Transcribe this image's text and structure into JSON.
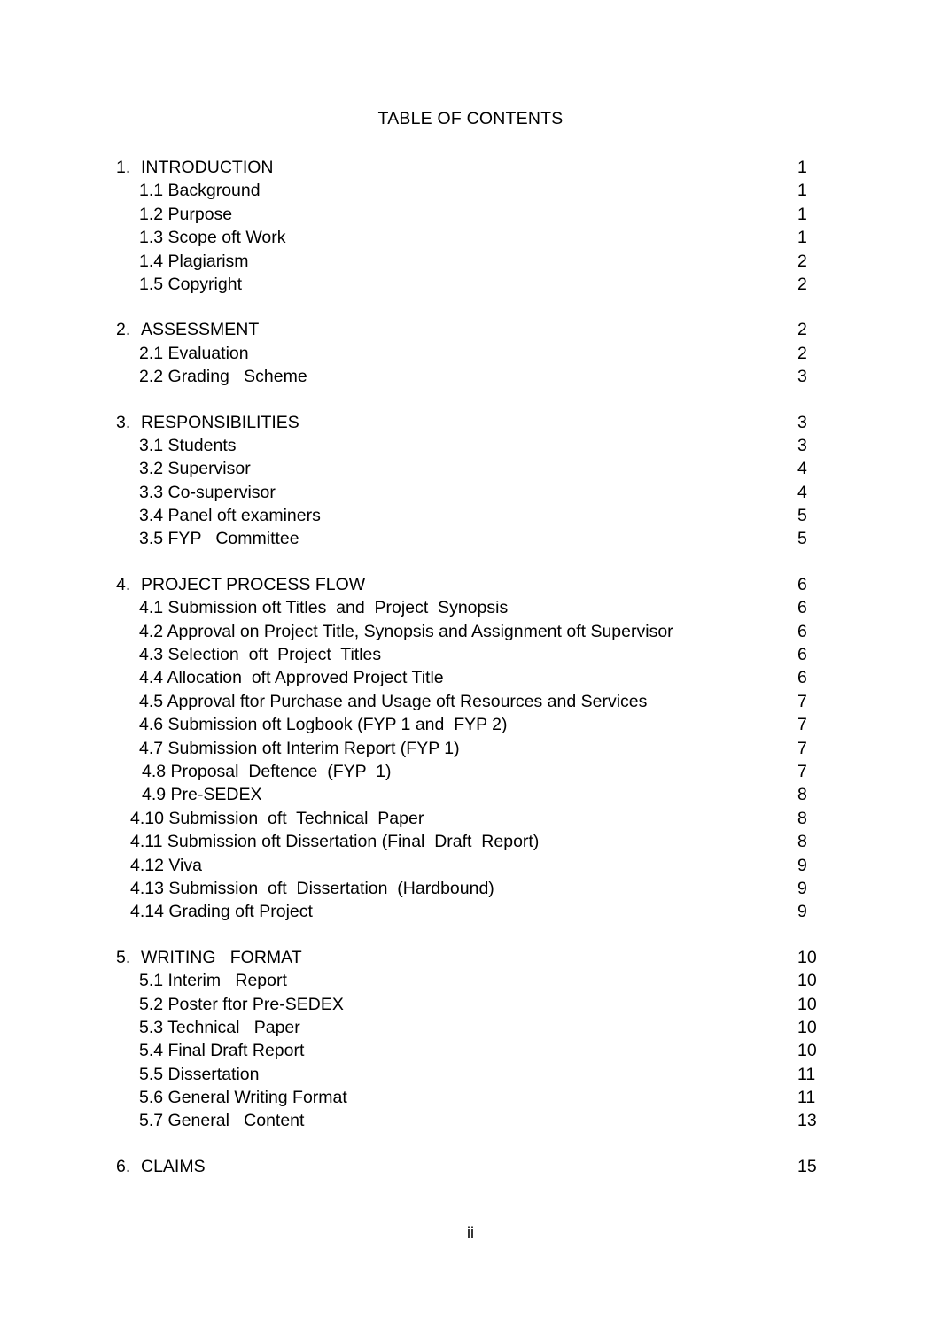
{
  "document": {
    "title": "TABLE OF CONTENTS",
    "folio": "ii"
  },
  "toc": {
    "sections": [
      {
        "number": "1.",
        "title": "INTRODUCTION",
        "page": "1",
        "items": [
          {
            "label": "1.1 Background",
            "page": "1"
          },
          {
            "label": "1.2 Purpose",
            "page": "1"
          },
          {
            "label": "1.3 Scope oft Work",
            "page": "1"
          },
          {
            "label": "1.4 Plagiarism",
            "page": "2"
          },
          {
            "label": "1.5 Copyright",
            "page": "2"
          }
        ]
      },
      {
        "number": "2.",
        "title": "ASSESSMENT",
        "page": "2",
        "items": [
          {
            "label": "2.1 Evaluation",
            "page": "2"
          },
          {
            "label": "2.2 Grading   Scheme",
            "page": "3"
          }
        ]
      },
      {
        "number": "3.",
        "title": "RESPONSIBILITIES",
        "page": "3",
        "items": [
          {
            "label": "3.1 Students",
            "page": "3"
          },
          {
            "label": "3.2 Supervisor",
            "page": "4"
          },
          {
            "label": "3.3 Co-supervisor",
            "page": "4"
          },
          {
            "label": "3.4 Panel oft examiners",
            "page": "5"
          },
          {
            "label": "3.5 FYP   Committee",
            "page": "5"
          }
        ]
      },
      {
        "number": "4.",
        "title": "PROJECT PROCESS FLOW",
        "page": "6",
        "items": [
          {
            "label": "4.1 Submission oft Titles  and  Project  Synopsis",
            "page": "6"
          },
          {
            "label": "4.2 Approval on Project Title, Synopsis and Assignment oft Supervisor",
            "page": "6"
          },
          {
            "label": "4.3 Selection  oft  Project  Titles",
            "page": "6"
          },
          {
            "label": "4.4 Allocation  oft Approved Project Title",
            "page": "6"
          },
          {
            "label": "4.5 Approval ftor Purchase and Usage oft Resources and Services",
            "page": "7"
          },
          {
            "label": "4.6 Submission oft Logbook (FYP 1 and  FYP 2)",
            "page": "7"
          },
          {
            "label": "4.7 Submission oft Interim Report (FYP 1)",
            "page": "7"
          },
          {
            "label": "4.8 Proposal  Deftence  (FYP  1)",
            "page": "7",
            "indent": "a"
          },
          {
            "label": "4.9 Pre-SEDEX",
            "page": "8",
            "indent": "a"
          },
          {
            "label": "4.10 Submission  oft  Technical  Paper",
            "page": "8",
            "indent": "b"
          },
          {
            "label": "4.11 Submission oft Dissertation (Final  Draft  Report)",
            "page": "8",
            "indent": "b"
          },
          {
            "label": "4.12 Viva",
            "page": "9",
            "indent": "b"
          },
          {
            "label": "4.13 Submission  oft  Dissertation  (Hardbound)",
            "page": "9",
            "indent": "b"
          },
          {
            "label": "4.14 Grading oft Project",
            "page": "9",
            "indent": "b"
          }
        ]
      },
      {
        "number": "5.",
        "title": "WRITING   FORMAT",
        "page": "10",
        "items": [
          {
            "label": "5.1 Interim   Report",
            "page": "10"
          },
          {
            "label": "5.2 Poster ftor Pre-SEDEX",
            "page": "10"
          },
          {
            "label": "5.3 Technical   Paper",
            "page": "10"
          },
          {
            "label": "5.4 Final Draft Report",
            "page": "10"
          },
          {
            "label": "5.5 Dissertation",
            "page": "11"
          },
          {
            "label": "5.6 General Writing Format",
            "page": "11"
          },
          {
            "label": "5.7 General   Content",
            "page": "13"
          }
        ]
      },
      {
        "number": "6.",
        "title": "CLAIMS",
        "page": "15",
        "items": []
      }
    ]
  }
}
